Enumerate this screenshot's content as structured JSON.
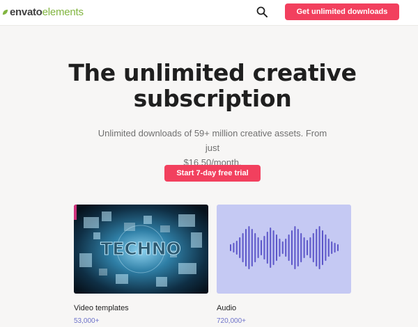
{
  "header": {
    "logo": {
      "word1": "envato",
      "word2": "elements",
      "leaf_color": "#82b541"
    },
    "search_icon": "search-icon",
    "cta_label": "Get unlimited downloads"
  },
  "hero": {
    "title_line1": "The unlimited creative",
    "title_line2": "subscription",
    "subtitle_line1": "Unlimited downloads of 59+ million creative assets. From just",
    "subtitle_line2": "$16.50/month.",
    "cta_label": "Start 7-day free trial"
  },
  "categories": [
    {
      "label": "Video templates",
      "count": "53,000+",
      "thumb_text": "TECHNO"
    },
    {
      "label": "Audio",
      "count": "720,000+",
      "icon": "waveform-icon"
    }
  ],
  "colors": {
    "accent": "#f2405e",
    "count": "#6d72c9",
    "audio_bg": "#c5c9f3",
    "waveform": "#5c56c9"
  }
}
